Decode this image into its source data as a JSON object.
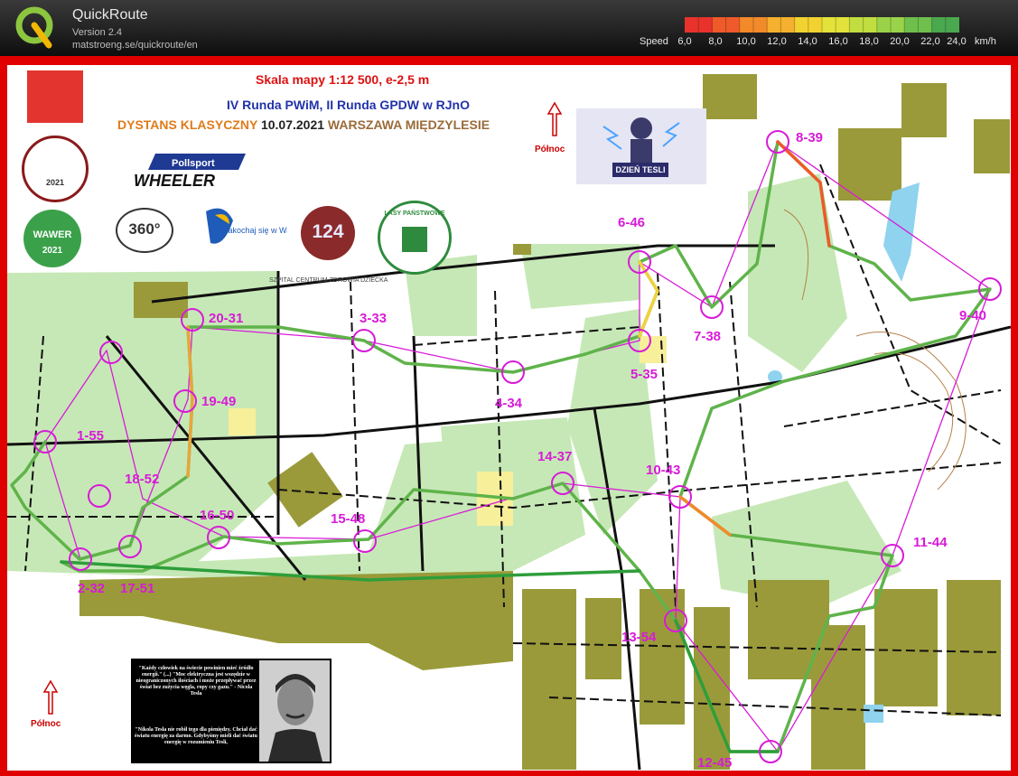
{
  "app": {
    "logo_letter": "Q",
    "title": "QuickRoute",
    "version": "Version 2.4",
    "url": "matstroeng.se/quickroute/en"
  },
  "speed_legend": {
    "label": "Speed",
    "ticks": [
      "6,0",
      "8,0",
      "10,0",
      "12,0",
      "14,0",
      "16,0",
      "18,0",
      "20,0",
      "22,0",
      "24,0"
    ],
    "unit": "km/h",
    "colors": [
      "#e8322b",
      "#ee5a2a",
      "#f28a2a",
      "#f4b02e",
      "#f2d230",
      "#e2e23a",
      "#c2dd40",
      "#9ad24a",
      "#6fbf4d",
      "#4aa84f"
    ]
  },
  "map_header": {
    "scale": "Skala mapy 1:12 500, e-2,5 m",
    "event": "IV Runda PWiM, II Runda GPDW w RJnO",
    "discipline": "DYSTANS KLASYCZNY",
    "date": "10.07.2021",
    "location": "WARSZAWA MIĘDZYLESIE",
    "north_label": "Północ",
    "hospital_label": "SZPITAL CENTRUM ZDROWIA DZIECKA"
  },
  "sponsors": {
    "wheeler_brand": "Pollsport",
    "wheeler_name": "WHEELER",
    "wawer_text": "WAWER",
    "wawer_year": "2021",
    "badge_2021": "2021",
    "logo_360": "360°",
    "zakochaj_text": "zakochaj się w Wawrze",
    "logo_124": "124",
    "lasy_text": "LASY PAŃSTWOWE",
    "tesla_label": "DZIEŃ TESLI"
  },
  "quote": {
    "text_1": "\"Każdy człowiek na świecie powinien mieć źródło energii.\" (...) \"Moc elektryczna jest wszędzie w nieograniczonych ilościach i może przepływać przez świat bez zużycia węgla, ropy czy gazu.\" - Nicola Tesla",
    "text_2": "\"Nikola Tesla nie robił tego dla pieniędzy. Chciał dać światu energię za darmo. Gdybyśmy mieli dać światu energię w rozumieniu Tesli,",
    "north_label": "Północ"
  },
  "controls": [
    {
      "label": "1-55"
    },
    {
      "label": "2-32"
    },
    {
      "label": "3-33"
    },
    {
      "label": "4-34"
    },
    {
      "label": "5-35"
    },
    {
      "label": "6-46"
    },
    {
      "label": "7-38"
    },
    {
      "label": "8-39"
    },
    {
      "label": "9-40"
    },
    {
      "label": "10-43"
    },
    {
      "label": "11-44"
    },
    {
      "label": "12-45"
    },
    {
      "label": "13-54"
    },
    {
      "label": "14-37"
    },
    {
      "label": "15-48"
    },
    {
      "label": "16-50"
    },
    {
      "label": "17-51"
    },
    {
      "label": "18-52"
    },
    {
      "label": "19-49"
    },
    {
      "label": "20-31"
    }
  ],
  "colors": {
    "frame": "#e00000",
    "control": "#d81bd8",
    "vegetation": "#c6e8b6",
    "buildings": "#9a9a3a",
    "route_fast": "#2e9e3a",
    "route_slow": "#e8322b"
  }
}
